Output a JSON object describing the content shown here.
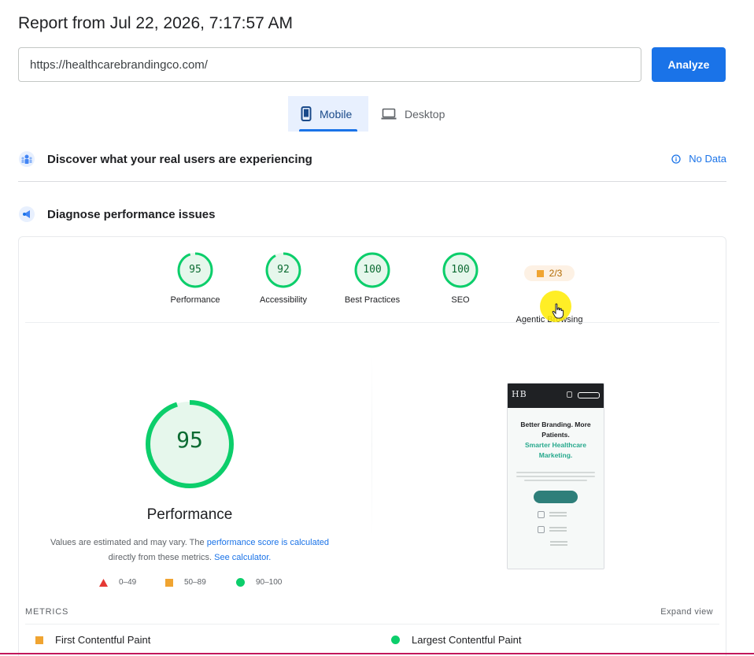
{
  "report": {
    "title": "Report from Jul 22, 2026, 7:17:57 AM"
  },
  "search": {
    "value": "https://healthcarebrandingco.com/",
    "analyze_label": "Analyze"
  },
  "tabs": [
    {
      "label": "Mobile",
      "icon": "smartphone-icon",
      "active": true
    },
    {
      "label": "Desktop",
      "icon": "laptop-icon",
      "active": false
    }
  ],
  "field_data": {
    "title": "Discover what your real users are experiencing",
    "status_label": "No Data",
    "icon": "users-icon"
  },
  "diagnose": {
    "title": "Diagnose performance issues",
    "icon": "lighthouse-icon"
  },
  "categories": [
    {
      "label": "Performance",
      "score": "95"
    },
    {
      "label": "Accessibility",
      "score": "92"
    },
    {
      "label": "Best Practices",
      "score": "100"
    },
    {
      "label": "SEO",
      "score": "100"
    },
    {
      "label": "Agentic Browsing",
      "score": "2/3"
    }
  ],
  "performance": {
    "score": "95",
    "label": "Performance",
    "note_prefix": "Values are estimated and may vary. The ",
    "note_link1": "performance score is calculated",
    "note_middle": "directly from these metrics. ",
    "note_link2": "See calculator."
  },
  "legend": [
    {
      "range": "0–49",
      "color": "#e53935",
      "shape": "triangle"
    },
    {
      "range": "50–89",
      "color": "#f0a431",
      "shape": "square"
    },
    {
      "range": "90–100",
      "color": "#0cce6b",
      "shape": "circle"
    }
  ],
  "screenshot": {
    "logo": "HB",
    "headline": "Better Branding. More Patients.",
    "subheadline": "Smarter Healthcare Marketing."
  },
  "metrics": {
    "title": "METRICS",
    "expand_label": "Expand view",
    "items": [
      {
        "label": "First Contentful Paint",
        "status": "average"
      },
      {
        "label": "Largest Contentful Paint",
        "status": "pass"
      }
    ]
  },
  "colors": {
    "accent": "#1a73e8",
    "pass": "#0cce6b",
    "average": "#f0a431",
    "fail": "#e53935"
  }
}
